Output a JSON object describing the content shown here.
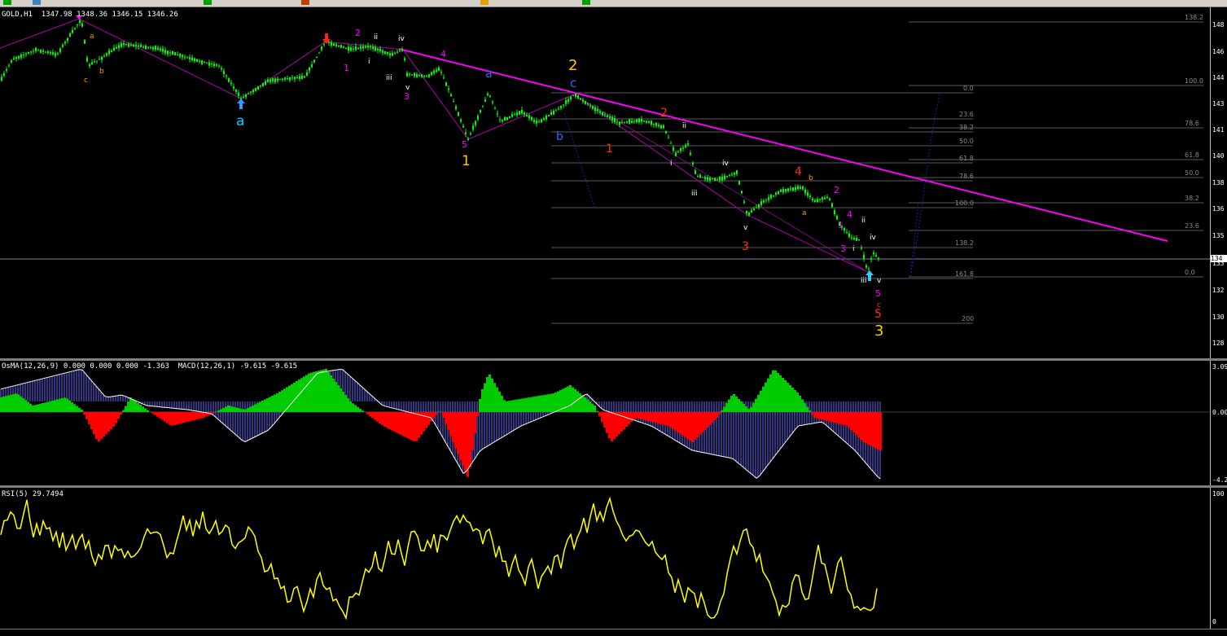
{
  "chart": {
    "symbol_header": "GOLD,H1  1347.98 1348.36 1346.15 1346.26",
    "price_axis_ticks": [
      "148",
      "146",
      "144",
      "143",
      "141",
      "140",
      "138",
      "136",
      "135",
      "133",
      "132",
      "130",
      "128"
    ],
    "last_price_tag": "134",
    "wave_labels": [
      {
        "t": "a",
        "c": "#ff9900"
      },
      {
        "t": "c",
        "c": "#ff9900"
      },
      {
        "t": "b",
        "c": "#ff9900"
      },
      {
        "t": "a",
        "c": "#00ccff"
      },
      {
        "t": "2",
        "c": "#ff00ff"
      },
      {
        "t": "ii",
        "c": "#ffffff"
      },
      {
        "t": "iv",
        "c": "#ffffff"
      },
      {
        "t": "i",
        "c": "#ffffff"
      },
      {
        "t": "1",
        "c": "#ff00ff"
      },
      {
        "t": "iii",
        "c": "#ffffff"
      },
      {
        "t": "v",
        "c": "#ffffff"
      },
      {
        "t": "3",
        "c": "#ff00ff"
      },
      {
        "t": "4",
        "c": "#ff00ff"
      },
      {
        "t": "5",
        "c": "#ff00ff"
      },
      {
        "t": "1",
        "c": "#ffcc00"
      },
      {
        "t": "a",
        "c": "#3366ff"
      },
      {
        "t": "2",
        "c": "#ffcc00"
      },
      {
        "t": "c",
        "c": "#3366ff"
      },
      {
        "t": "b",
        "c": "#3366ff"
      },
      {
        "t": "1",
        "c": "#ff3300"
      },
      {
        "t": "2",
        "c": "#ff3300"
      },
      {
        "t": "ii",
        "c": "#ffffff"
      },
      {
        "t": "i",
        "c": "#ffffff"
      },
      {
        "t": "iii",
        "c": "#ffffff"
      },
      {
        "t": "iv",
        "c": "#ffffff"
      },
      {
        "t": "v",
        "c": "#ffffff"
      },
      {
        "t": "3",
        "c": "#ff3300"
      },
      {
        "t": "4",
        "c": "#ff3300"
      },
      {
        "t": "b",
        "c": "#ff9900"
      },
      {
        "t": "a",
        "c": "#ff9900"
      },
      {
        "t": "2",
        "c": "#ff00ff"
      },
      {
        "t": "1",
        "c": "#ff00ff"
      },
      {
        "t": "4",
        "c": "#ff00ff"
      },
      {
        "t": "ii",
        "c": "#ffffff"
      },
      {
        "t": "3",
        "c": "#ff00ff"
      },
      {
        "t": "i",
        "c": "#ffffff"
      },
      {
        "t": "iv",
        "c": "#ffffff"
      },
      {
        "t": "iii",
        "c": "#ffffff"
      },
      {
        "t": "v",
        "c": "#ffffff"
      },
      {
        "t": "5",
        "c": "#ff00ff"
      },
      {
        "t": "c",
        "c": "#ff3300"
      },
      {
        "t": "5",
        "c": "#ff3300"
      },
      {
        "t": "3",
        "c": "#ffcc00"
      }
    ],
    "fib_left": [
      "0.0",
      "23.6",
      "38.2",
      "50.0",
      "61.8",
      "78.6",
      "100.0",
      "138.2",
      "161.8",
      "200"
    ],
    "fib_right": [
      "138.2",
      "100.0",
      "78.6",
      "61.8",
      "50.0",
      "38.2",
      "23.6",
      "0.0"
    ]
  },
  "osma": {
    "header": "OsMA(12,26,9) 0.000 0.000 0.000 -1.363  MACD(12,26,1) -9.615 -9.615",
    "ticks": [
      "3.09",
      "0.00",
      "-4.27"
    ]
  },
  "rsi": {
    "header": "RSI(5) 29.7494",
    "ticks": [
      "100",
      "0"
    ]
  },
  "colors": {
    "candle": "#00ff00",
    "trendline": "#ff00ff",
    "rsi": "#ffff00",
    "osma_pos": "#00cc00",
    "osma_neg": "#ff0000",
    "macd_hist": "#6666ff"
  }
}
